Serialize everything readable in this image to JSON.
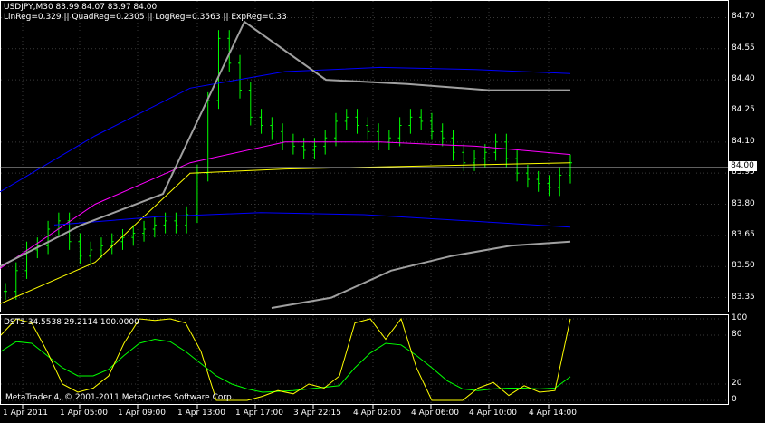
{
  "header": {
    "symbol_line": "USDJPY,M30  83.99 84.07 83.97 84.00",
    "indicator_line": "LinReg=0.329  ||  QuadReg=0.2305  ||  LogReg=0.3563  ||  ExpReg=0.33"
  },
  "price_axis": {
    "labels": [
      "84.70",
      "84.55",
      "84.40",
      "84.25",
      "84.10",
      "83.95",
      "83.80",
      "83.65",
      "83.50",
      "83.35"
    ],
    "current_price": "84.00"
  },
  "subwindow": {
    "title": "DST3 34.5538 29.2114 100.0000",
    "levels": [
      "100",
      "80",
      "20",
      "0"
    ],
    "copyright": "MetaTrader 4, © 2001-2011 MetaQuotes Software Corp."
  },
  "time_axis": {
    "labels": [
      "1 Apr 2011",
      "1 Apr 05:00",
      "1 Apr 09:00",
      "1 Apr 13:00",
      "1 Apr 17:00",
      "3 Apr 22:15",
      "4 Apr 02:00",
      "4 Apr 06:00",
      "4 Apr 10:00",
      "4 Apr 14:00"
    ]
  },
  "colors": {
    "background": "#000000",
    "candles": "#00ff00",
    "regression_blue": "#0000ff",
    "regression_magenta": "#ff00ff",
    "regression_yellow": "#ffff00",
    "regression_gray": "#a0a0a0",
    "grid": "#3a3a3a"
  },
  "chart_data": {
    "type": "line",
    "title": "",
    "ylim": [
      83.3,
      84.75
    ],
    "grid": true,
    "categories": [
      "1 Apr 2011",
      "1 Apr 05:00",
      "1 Apr 09:00",
      "1 Apr 13:00",
      "1 Apr 17:00",
      "3 Apr 22:15",
      "4 Apr 02:00",
      "4 Apr 06:00",
      "4 Apr 10:00",
      "4 Apr 14:00"
    ],
    "series": [
      {
        "values": [
          83.86,
          84.13,
          84.36,
          84.44,
          84.46,
          84.45,
          84.43
        ]
      },
      {
        "values": [
          83.49,
          83.8,
          84.0,
          84.1,
          84.1,
          84.08,
          84.04
        ]
      },
      {
        "values": [
          83.32,
          83.52,
          83.95,
          83.97,
          83.98,
          83.99,
          84.0
        ]
      },
      {
        "values": [
          83.3,
          83.35,
          83.48,
          83.55,
          83.6,
          83.62
        ]
      },
      {
        "values": [
          83.7,
          83.74,
          83.76,
          83.75,
          83.72,
          83.69
        ]
      },
      {
        "values": [
          83.5,
          83.7,
          83.85,
          84.68,
          84.4,
          84.38,
          84.35,
          84.35
        ]
      }
    ],
    "closes": [
      83.38,
      83.48,
      83.58,
      83.6,
      83.68,
      83.72,
      83.62,
      83.55,
      83.58,
      83.6,
      83.62,
      83.64,
      83.66,
      83.68,
      83.7,
      83.72,
      83.7,
      83.75,
      83.95,
      84.3,
      84.6,
      84.48,
      84.35,
      84.22,
      84.18,
      84.15,
      84.1,
      84.08,
      84.06,
      84.08,
      84.12,
      84.2,
      84.22,
      84.18,
      84.15,
      84.1,
      84.12,
      84.18,
      84.22,
      84.2,
      84.15,
      84.12,
      84.05,
      84.0,
      84.02,
      84.05,
      84.1,
      84.02,
      83.95,
      83.92,
      83.9,
      83.88,
      83.94,
      84.0
    ],
    "oscillator": {
      "name": "DST3",
      "levels": [
        100,
        80,
        20,
        0
      ],
      "fast": [
        80,
        100,
        95,
        60,
        20,
        10,
        15,
        30,
        70,
        100,
        98,
        100,
        95,
        60,
        0,
        0,
        0,
        5,
        12,
        8,
        20,
        15,
        30,
        95,
        100,
        75,
        100,
        40,
        0,
        0,
        0,
        15,
        22,
        6,
        18,
        10,
        12,
        100
      ],
      "slow": [
        60,
        72,
        70,
        55,
        40,
        30,
        30,
        38,
        55,
        70,
        75,
        72,
        60,
        45,
        30,
        20,
        14,
        10,
        11,
        12,
        14,
        16,
        18,
        40,
        58,
        70,
        68,
        55,
        40,
        24,
        14,
        12,
        14,
        15,
        15,
        14,
        15,
        29
      ]
    }
  }
}
